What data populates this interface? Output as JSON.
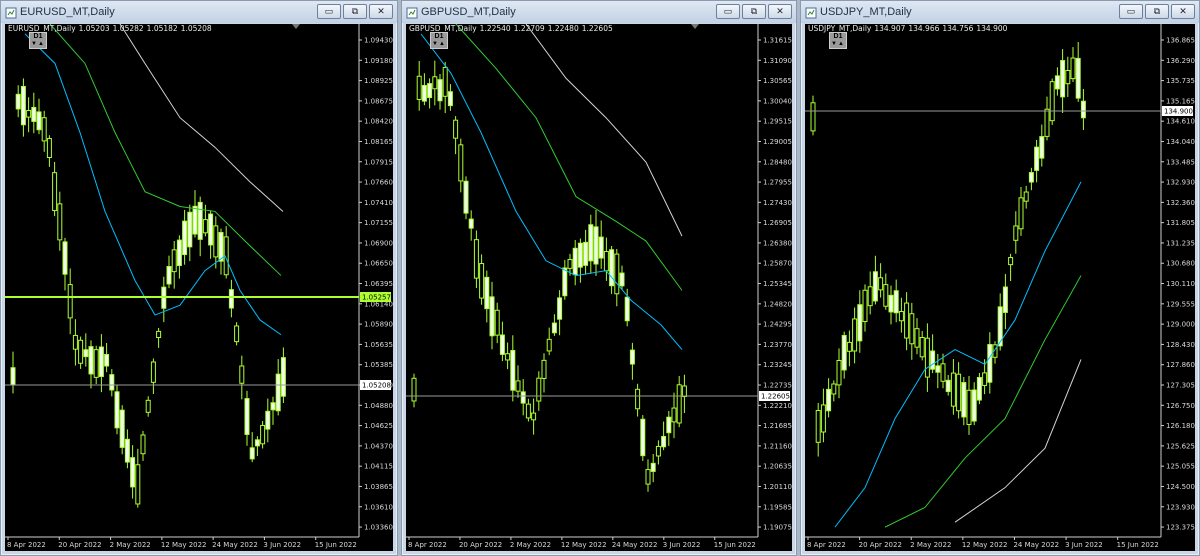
{
  "windows": [
    {
      "id": "eurusd",
      "title": "EURUSD_MT,Daily",
      "symbol_line": {
        "symbol": "EURUSD_MT,Daily",
        "open": "1.05203",
        "high": "1.05282",
        "low": "1.05182",
        "close": "1.05208"
      },
      "timeframe": "D1",
      "price_labels": [
        "1.09430",
        "1.09180",
        "1.08925",
        "1.08675",
        "1.08420",
        "1.08165",
        "1.07915",
        "1.07660",
        "1.07410",
        "1.07155",
        "1.06900",
        "1.06650",
        "1.06395",
        "1.06140",
        "1.05890",
        "1.05635",
        "1.05385",
        "1.05130",
        "1.04880",
        "1.04625",
        "1.04370",
        "1.04115",
        "1.03865",
        "1.03610",
        "1.03360"
      ],
      "date_labels": [
        "8 Apr 2022",
        "20 Apr 2022",
        "2 May 2022",
        "12 May 2022",
        "24 May 2022",
        "3 Jun 2022",
        "15 Jun 2022"
      ],
      "bid_price": "1.05208",
      "hline_price": "1.05257",
      "colors": {
        "bid_tag": "#ffffff",
        "hline": "#adff2f"
      }
    },
    {
      "id": "gbpusd",
      "title": "GBPUSD_MT,Daily",
      "symbol_line": {
        "symbol": "GBPUSD_MT,Daily",
        "open": "1.22540",
        "high": "1.22709",
        "low": "1.22480",
        "close": "1.22605"
      },
      "timeframe": "D1",
      "price_labels": [
        "1.31615",
        "1.31090",
        "1.30565",
        "1.30040",
        "1.29515",
        "1.29005",
        "1.28480",
        "1.27955",
        "1.27430",
        "1.26905",
        "1.26380",
        "1.25870",
        "1.25345",
        "1.24820",
        "1.24295",
        "1.23770",
        "1.23245",
        "1.22735",
        "1.22210",
        "1.21685",
        "1.21160",
        "1.20635",
        "1.20110",
        "1.19585",
        "1.19075"
      ],
      "date_labels": [
        "8 Apr 2022",
        "20 Apr 2022",
        "2 May 2022",
        "12 May 2022",
        "24 May 2022",
        "3 Jun 2022",
        "15 Jun 2022"
      ],
      "bid_price": "1.22605",
      "colors": {
        "bid_tag": "#ffffff"
      }
    },
    {
      "id": "usdjpy",
      "title": "USDJPY_MT,Daily",
      "symbol_line": {
        "symbol": "USDJPY_MT,Daily",
        "open": "134.907",
        "high": "134.966",
        "low": "134.756",
        "close": "134.900"
      },
      "timeframe": "D1",
      "price_labels": [
        "136.865",
        "136.290",
        "135.735",
        "135.165",
        "134.610",
        "134.040",
        "133.485",
        "132.930",
        "132.360",
        "131.805",
        "131.235",
        "130.680",
        "130.110",
        "129.555",
        "129.000",
        "128.430",
        "127.860",
        "127.305",
        "126.750",
        "126.180",
        "125.625",
        "125.055",
        "124.500",
        "123.930",
        "123.375"
      ],
      "date_labels": [
        "8 Apr 2022",
        "20 Apr 2022",
        "2 May 2022",
        "12 May 2022",
        "24 May 2022",
        "3 Jun 2022",
        "15 Jun 2022"
      ],
      "bid_price": "134.900",
      "colors": {
        "bid_tag": "#ffffff"
      }
    }
  ],
  "title_buttons": {
    "minimize": "▭",
    "maximize": "⧉",
    "close": "✕"
  },
  "colors": {
    "candle": "#adff2f",
    "ma_fast": "#00bfff",
    "ma_mid": "#32cd32",
    "ma_slow": "#d3d3d3",
    "chart_bg": "#000000"
  }
}
